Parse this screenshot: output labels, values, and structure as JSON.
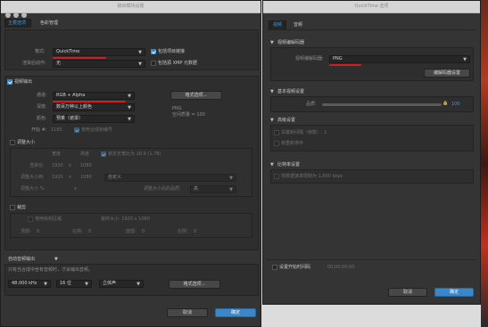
{
  "left_window": {
    "title": "输出模块设置",
    "tabs": [
      "主要选项",
      "色彩管理"
    ],
    "format_label": "格式:",
    "format_value": "QuickTime",
    "include_project_link": "包括项目链接",
    "post_render_label": "渲染后动作:",
    "post_render_value": "无",
    "include_xmp": "包括源 XMP 元数据",
    "video_output": "视频输出",
    "channels_label": "通道:",
    "channels_value": "RGB + Alpha",
    "format_options_button": "格式选项...",
    "depth_label": "深度:",
    "depth_value": "数百万种以上颜色",
    "codec_info_name": "PNG",
    "codec_info_quality": "空间质量 = 100",
    "color_label": "颜色:",
    "color_value": "预乘（遮罩）",
    "start_label": "开始 #:",
    "start_value": "1165",
    "use_comp_frame": "使用合成帧编号",
    "resize": "调整大小",
    "col_width": "宽度",
    "col_height": "高度",
    "lock_ratio": "锁定长宽比为 16:9 (1.78)",
    "render_at_label": "渲染在:",
    "render_at_w": "1920",
    "render_at_h": "1080",
    "resize_to_label": "调整大小到:",
    "resize_to_w": "1920",
    "resize_to_h": "1080",
    "resize_to_preset": "自定义",
    "resize_pct_label": "调整大小 %:",
    "resize_pct_x": "x",
    "resize_quality_label": "调整大小后的品质:",
    "resize_quality_value": "高",
    "crop": "裁剪",
    "use_roi": "使用目标区域",
    "final_size": "最终大小: 1920 x 1080",
    "top_label": "顶部:",
    "top_value": "0",
    "left_label": "左侧:",
    "left_value": "0",
    "bottom_label": "底部:",
    "bottom_value": "0",
    "right_label": "右侧:",
    "right_value": "0",
    "auto_audio": "自动音频输出",
    "audio_note": "只有当合成中含有音频时，才会输出音频。",
    "sample_rate": "48.000 kHz",
    "bit_depth": "16 位",
    "stereo": "立体声",
    "audio_format_button": "格式选项...",
    "cancel": "取消",
    "ok": "确定"
  },
  "right_window": {
    "title": "QuickTime 选项",
    "tabs": [
      "视频",
      "音频"
    ],
    "codec_section": "视频编解码器",
    "codec_label": "视频编解码器:",
    "codec_value": "PNG",
    "codec_settings_button": "编解码器设置",
    "basic_section": "基本视频设置",
    "quality_label": "品质:",
    "quality_value": "100",
    "advanced_section": "高级设置",
    "keyframe": "关键帧间隔（帧数）: 1",
    "frame_reorder": "帧重新排序",
    "bitrate_section": "比特率设置",
    "bitrate_limit": "将数据速率限制为  1,600 kbps",
    "set_start_timecode": "设置开始时间码",
    "timecode_value": "00;00;00;00",
    "cancel": "取消",
    "ok": "确定"
  },
  "colors": {
    "accent_blue": "#3b86c7",
    "annotation_red": "#d11d1d",
    "panel_bg": "#343434"
  }
}
